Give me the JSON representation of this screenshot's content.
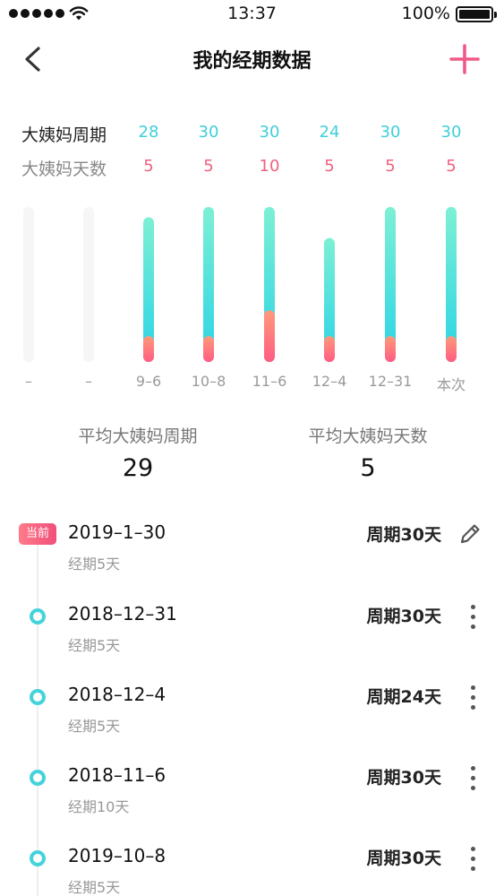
{
  "status_bar": {
    "time": "13:37",
    "battery": "100%"
  },
  "nav": {
    "title": "我的经期数据"
  },
  "stats": {
    "cycle_label": "大姨妈周期",
    "days_label": "大姨妈天数",
    "cycle_values": [
      "28",
      "30",
      "30",
      "24",
      "30",
      "30"
    ],
    "days_values": [
      "5",
      "5",
      "10",
      "5",
      "5",
      "5"
    ]
  },
  "chart_data": {
    "type": "bar",
    "categories": [
      "–",
      "–",
      "9–6",
      "10–8",
      "11–6",
      "12–4",
      "12–31",
      "本次"
    ],
    "series": [
      {
        "values": [
          null,
          null,
          28,
          30,
          30,
          24,
          30,
          30
        ]
      },
      {
        "values": [
          null,
          null,
          5,
          5,
          10,
          5,
          5,
          5
        ]
      }
    ],
    "ylim": [
      0,
      30
    ],
    "grid": false,
    "colors": {
      "cycle_top": "#7df0d4",
      "cycle_bottom": "#2ad3e6",
      "days_top": "#ff9a7a",
      "days_bottom": "#ff5c82",
      "empty_track": "#f6f6f6"
    }
  },
  "averages": {
    "cycle_label": "平均大姨妈周期",
    "cycle_value": "29",
    "days_label": "平均大姨妈天数",
    "days_value": "5"
  },
  "records": [
    {
      "date": "2019–1–30",
      "duration": "经期5天",
      "cycle": "周期30天",
      "badge": "当前",
      "action": "edit-icon"
    },
    {
      "date": "2018–12–31",
      "duration": "经期5天",
      "cycle": "周期30天",
      "action": "more-icon"
    },
    {
      "date": "2018–12–4",
      "duration": "经期5天",
      "cycle": "周期24天",
      "action": "more-icon"
    },
    {
      "date": "2018–11–6",
      "duration": "经期10天",
      "cycle": "周期30天",
      "action": "more-icon"
    },
    {
      "date": "2019–10–8",
      "duration": "经期5天",
      "cycle": "周期30天",
      "action": "more-icon"
    }
  ],
  "colors": {
    "accent_teal": "#3fcfd9",
    "accent_pink": "#f0607f",
    "add_button": "#f05a86"
  }
}
